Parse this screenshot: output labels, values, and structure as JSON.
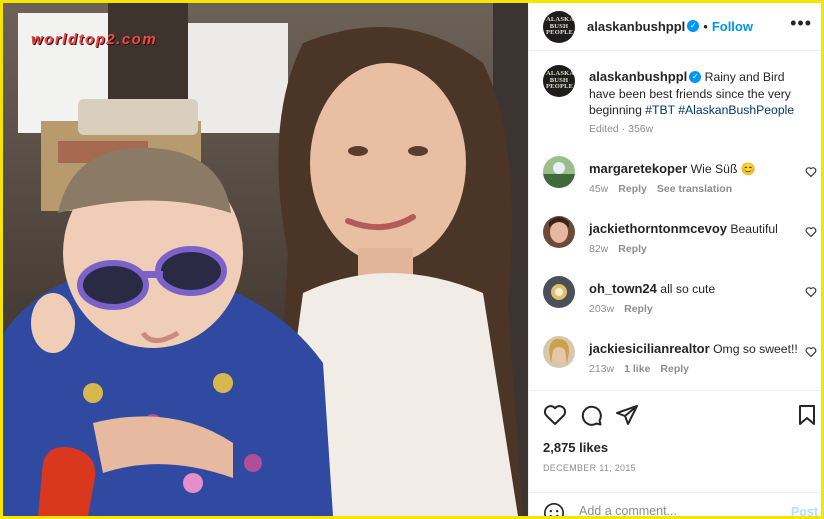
{
  "photo": {
    "watermark": "worldtop2.com"
  },
  "header": {
    "username": "alaskanbushppl",
    "follow_label": "Follow",
    "more_icon": "more-horizontal-icon",
    "avatar_text": "ALASKAN BUSH PEOPLE"
  },
  "caption": {
    "username": "alaskanbushppl",
    "text": "Rainy and Bird have been best friends since the very beginning",
    "hashtags": "#TBT #AlaskanBushPeople",
    "meta": "Edited · 356w"
  },
  "comments": [
    {
      "username": "margaretekoper",
      "text": "Wie Süß 😊",
      "time": "45w",
      "reply": "Reply",
      "extra": "See translation"
    },
    {
      "username": "jackiethorntonmcevoy",
      "text": "Beautiful",
      "time": "82w",
      "reply": "Reply",
      "extra": ""
    },
    {
      "username": "oh_town24",
      "text": "all so cute",
      "time": "203w",
      "reply": "Reply",
      "extra": ""
    },
    {
      "username": "jackiesicilianrealtor",
      "text": "Omg so sweet!!",
      "time": "213w",
      "likes": "1 like",
      "reply": "Reply"
    }
  ],
  "actions": {
    "likes": "2,875 likes",
    "date": "DECEMBER 11, 2015",
    "comment_placeholder": "Add a comment...",
    "post_label": "Post"
  },
  "colors": {
    "border": "#f5e600",
    "accent": "#0095f6",
    "watermark": "#e84d4d"
  }
}
